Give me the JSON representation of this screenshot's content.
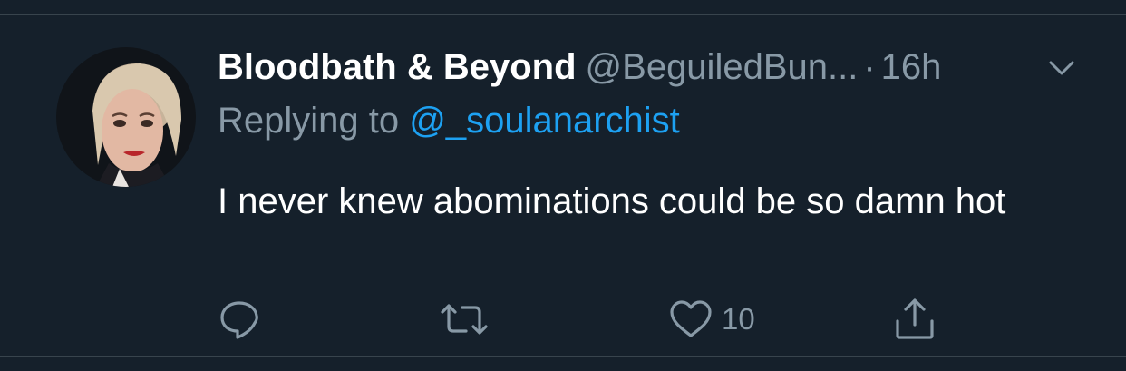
{
  "tweet": {
    "display_name": "Bloodbath & Beyond",
    "handle": "@BeguiledBun...",
    "separator": "·",
    "time": "16h",
    "replying_label": "Replying to ",
    "replying_to": "@_soulanarchist",
    "text": "I never knew abominations could be so damn hot"
  },
  "actions": {
    "reply_icon": "reply-icon",
    "retweet_icon": "retweet-icon",
    "like_icon": "heart-icon",
    "like_count": "10",
    "share_icon": "share-icon"
  },
  "colors": {
    "background": "#15202b",
    "divider": "#38444d",
    "primary_text": "#ffffff",
    "secondary_text": "#8899a6",
    "accent": "#1da1f2"
  }
}
